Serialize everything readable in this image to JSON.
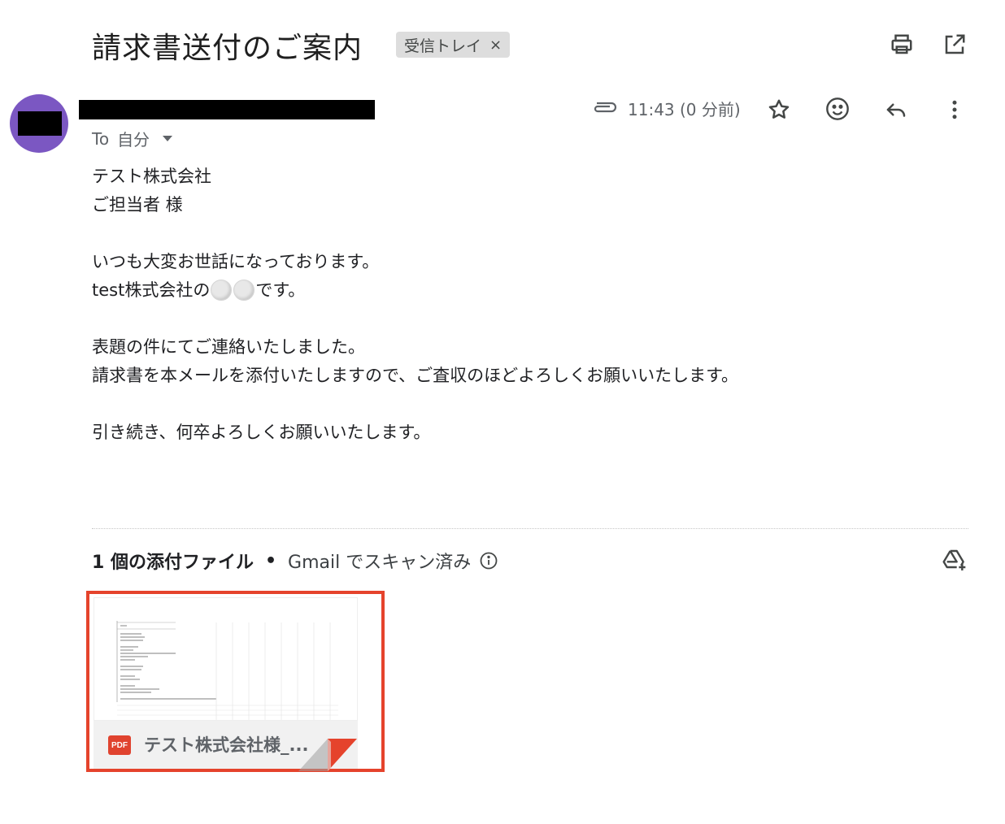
{
  "subject": "請求書送付のご案内",
  "label_chip": {
    "label": "受信トレイ",
    "remove": "×"
  },
  "recipient": {
    "to": "To",
    "name": "自分"
  },
  "time": "11:43 (0 分前)",
  "body": {
    "lines": [
      "テスト株式会社",
      "ご担当者 様",
      "",
      "いつも大変お世話になっております。",
      "",
      "",
      "表題の件にてご連絡いたしました。",
      "請求書を本メールを添付いたしますので、ご査収のほどよろしくお願いいたします。",
      "",
      "引き続き、何卒よろしくお願いいたします。"
    ],
    "line5_prefix": "test株式会社の",
    "line5_suffix": "です。"
  },
  "attachments": {
    "count_label": "1 個の添付ファイル",
    "separator": "•",
    "scan_label": "Gmail でスキャン済み",
    "file": {
      "type": "PDF",
      "name": "テスト株式会社様_..."
    }
  },
  "colors": {
    "avatar": "#7b57c2",
    "highlight_border": "#e5432c",
    "pdf": "#e0432f"
  },
  "icons": [
    "print-icon",
    "open-new-window-icon",
    "attachment-clip-icon",
    "star-icon",
    "emoji-icon",
    "reply-icon",
    "more-vert-icon",
    "info-icon",
    "drive-add-icon"
  ]
}
